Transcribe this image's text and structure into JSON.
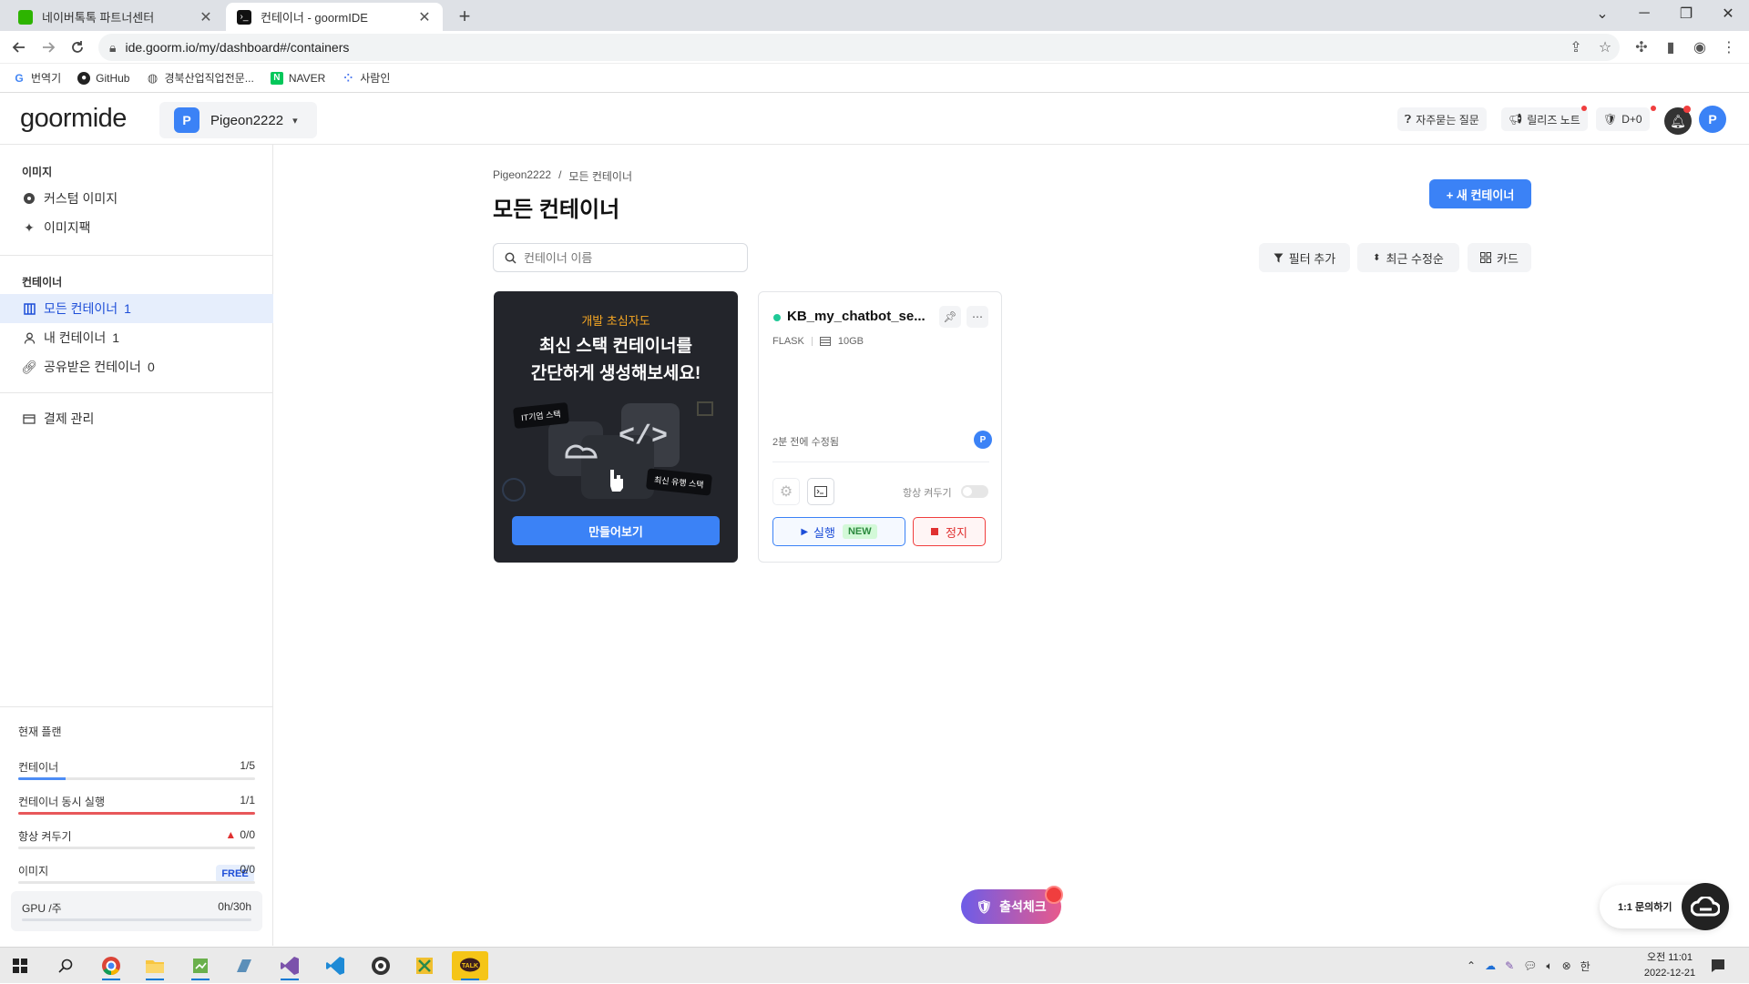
{
  "browser": {
    "tabs": [
      {
        "title": "네이버톡톡 파트너센터",
        "favicon_color": "#2db400"
      },
      {
        "title": "컨테이너 - goormIDE",
        "favicon_color": "#111111"
      }
    ],
    "url": "ide.goorm.io/my/dashboard#/containers",
    "bookmarks": [
      {
        "label": "번역기",
        "icon": "google-icon"
      },
      {
        "label": "GitHub",
        "icon": "github-icon"
      },
      {
        "label": "경북산업직업전문...",
        "icon": "globe-icon"
      },
      {
        "label": "NAVER",
        "icon": "naver-icon"
      },
      {
        "label": "사람인",
        "icon": "saramin-icon"
      }
    ]
  },
  "header": {
    "logo": "goormide",
    "workspace": {
      "initial": "P",
      "name": "Pigeon2222"
    },
    "faq": "자주묻는 질문",
    "release_notes": "릴리즈 노트",
    "dday": "D+0",
    "user_initial": "P"
  },
  "sidebar": {
    "image_section": "이미지",
    "images": [
      {
        "label": "커스텀 이미지",
        "icon": "custom-image-icon"
      },
      {
        "label": "이미지팩",
        "icon": "sparkle-icon"
      }
    ],
    "container_section": "컨테이너",
    "containers": [
      {
        "label": "모든 컨테이너",
        "count": "1",
        "icon": "grid-icon",
        "active": true
      },
      {
        "label": "내 컨테이너",
        "count": "1",
        "icon": "user-icon"
      },
      {
        "label": "공유받은 컨테이너",
        "count": "0",
        "icon": "link-icon"
      }
    ],
    "billing": "결제 관리",
    "plan": {
      "title": "현재 플랜",
      "badge": "FREE",
      "rows": [
        {
          "label": "컨테이너",
          "value": "1/5",
          "fraction": 0.2,
          "color": "#4c8cf5"
        },
        {
          "label": "컨테이너 동시 실행",
          "value": "1/1",
          "fraction": 1.0,
          "color": "#e8575a"
        },
        {
          "label": "항상 켜두기",
          "value": "0/0",
          "fraction": 0,
          "color": "#4c8cf5",
          "warning": true
        },
        {
          "label": "이미지",
          "value": "0/0",
          "fraction": 0,
          "color": "#4c8cf5"
        }
      ],
      "gpu": {
        "label": "GPU /주",
        "value": "0h/30h",
        "fraction": 0
      }
    }
  },
  "main": {
    "breadcrumb": [
      "Pigeon2222",
      "/",
      "모든 컨테이너"
    ],
    "title": "모든 컨테이너",
    "new_container": "+ 새 컨테이너",
    "search_placeholder": "컨테이너 이름",
    "filter_label": "필터 추가",
    "sort_label": "최근 수정순",
    "view_label": "카드",
    "promo": {
      "eyebrow": "개발 초심자도",
      "headline_1": "최신 스택 컨테이너를",
      "headline_2": "간단하게 생성해보세요!",
      "tag_1": "IT기업 스택",
      "tag_2": "최신 유행 스택",
      "button": "만들어보기"
    },
    "container": {
      "name": "KB_my_chatbot_se...",
      "stack": "FLASK",
      "storage": "10GB",
      "modified": "2분 전에 수정됨",
      "owner_initial": "P",
      "always_on_label": "항상 켜두기",
      "always_on": false,
      "run_label": "실행",
      "new_badge": "NEW",
      "stop_label": "정지",
      "status_color": "#20c997"
    }
  },
  "floating": {
    "attendance": "출석체크",
    "inquiry": "1:1 문의하기"
  },
  "taskbar": {
    "time": "오전 11:01",
    "date": "2022-12-21",
    "ime": "한"
  }
}
